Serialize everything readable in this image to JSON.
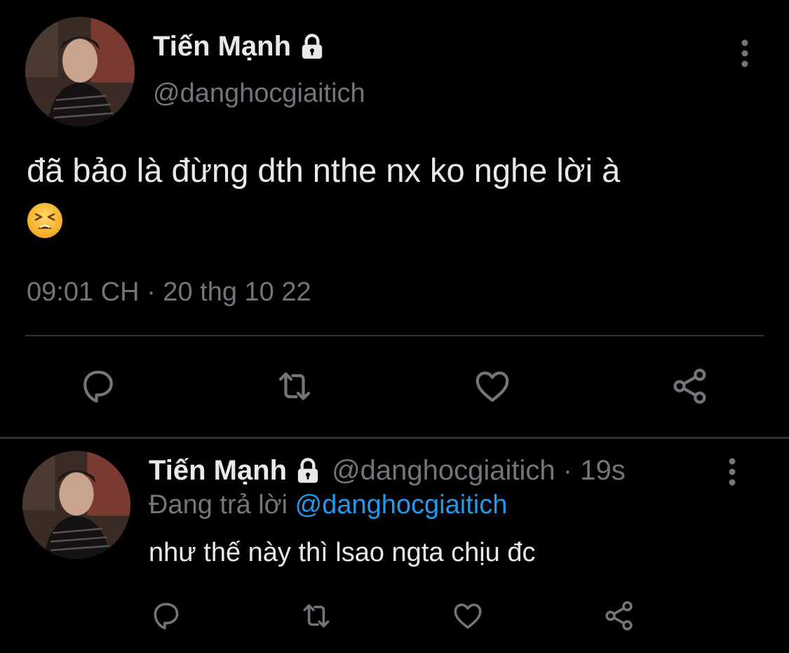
{
  "main_tweet": {
    "display_name": "Tiến Mạnh",
    "handle": "@danghocgiaitich",
    "text": "đã bảo là đừng dth nthe nx ko nghe lời à",
    "emoji": "tired-face-emoji",
    "timestamp": "09:01 CH · 20 thg 10 22",
    "protected": true
  },
  "reply_tweet": {
    "display_name": "Tiến Mạnh",
    "meta": "@danghocgiaitich · 19s",
    "replying_prefix": "Đang trả lời",
    "replying_to": "@danghocgiaitich",
    "text": "như thế này thì lsao ngta chịu đc",
    "protected": true
  },
  "icons": {
    "actions": [
      "reply-icon",
      "retweet-icon",
      "like-icon",
      "share-icon"
    ],
    "more": "more-vertical-icon",
    "lock": "lock-icon"
  },
  "colors": {
    "background": "#000000",
    "text": "#e7e9ea",
    "muted": "#71767b",
    "link": "#1d9bf0",
    "divider": "#2f3336"
  }
}
